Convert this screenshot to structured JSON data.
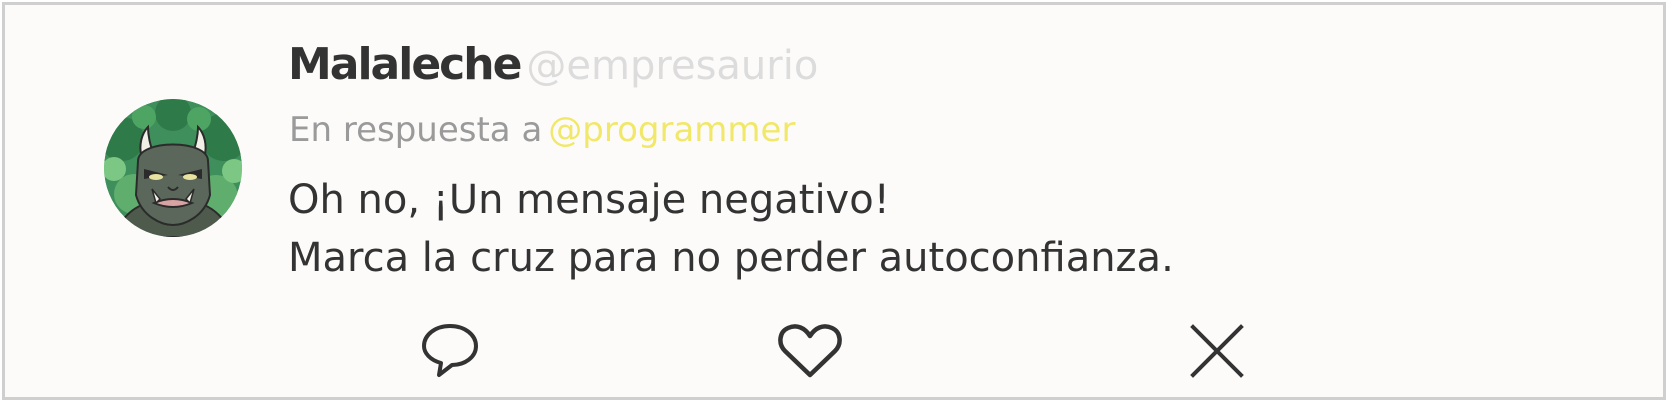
{
  "tweet": {
    "author": {
      "display_name": "Malaleche",
      "handle": "@empresaurio",
      "avatar_icon": "green-ogre-avatar"
    },
    "reply": {
      "prefix": "En respuesta a",
      "target_handle": "@programmer"
    },
    "message": {
      "line1": "Oh no, ¡Un mensaje negativo!",
      "line2": "Marca la cruz para no perder autoconfianza."
    },
    "actions": {
      "reply_icon": "speech-bubble-icon",
      "like_icon": "heart-icon",
      "dismiss_icon": "close-icon"
    }
  },
  "colors": {
    "card_background": "#fdfbfa",
    "card_border": "#cfcfcf",
    "name_text": "#333333",
    "handle_text": "#dcdcdc",
    "reply_text": "#9a9a9a",
    "reply_handle": "#f1e86a",
    "icon_stroke": "#333333"
  }
}
